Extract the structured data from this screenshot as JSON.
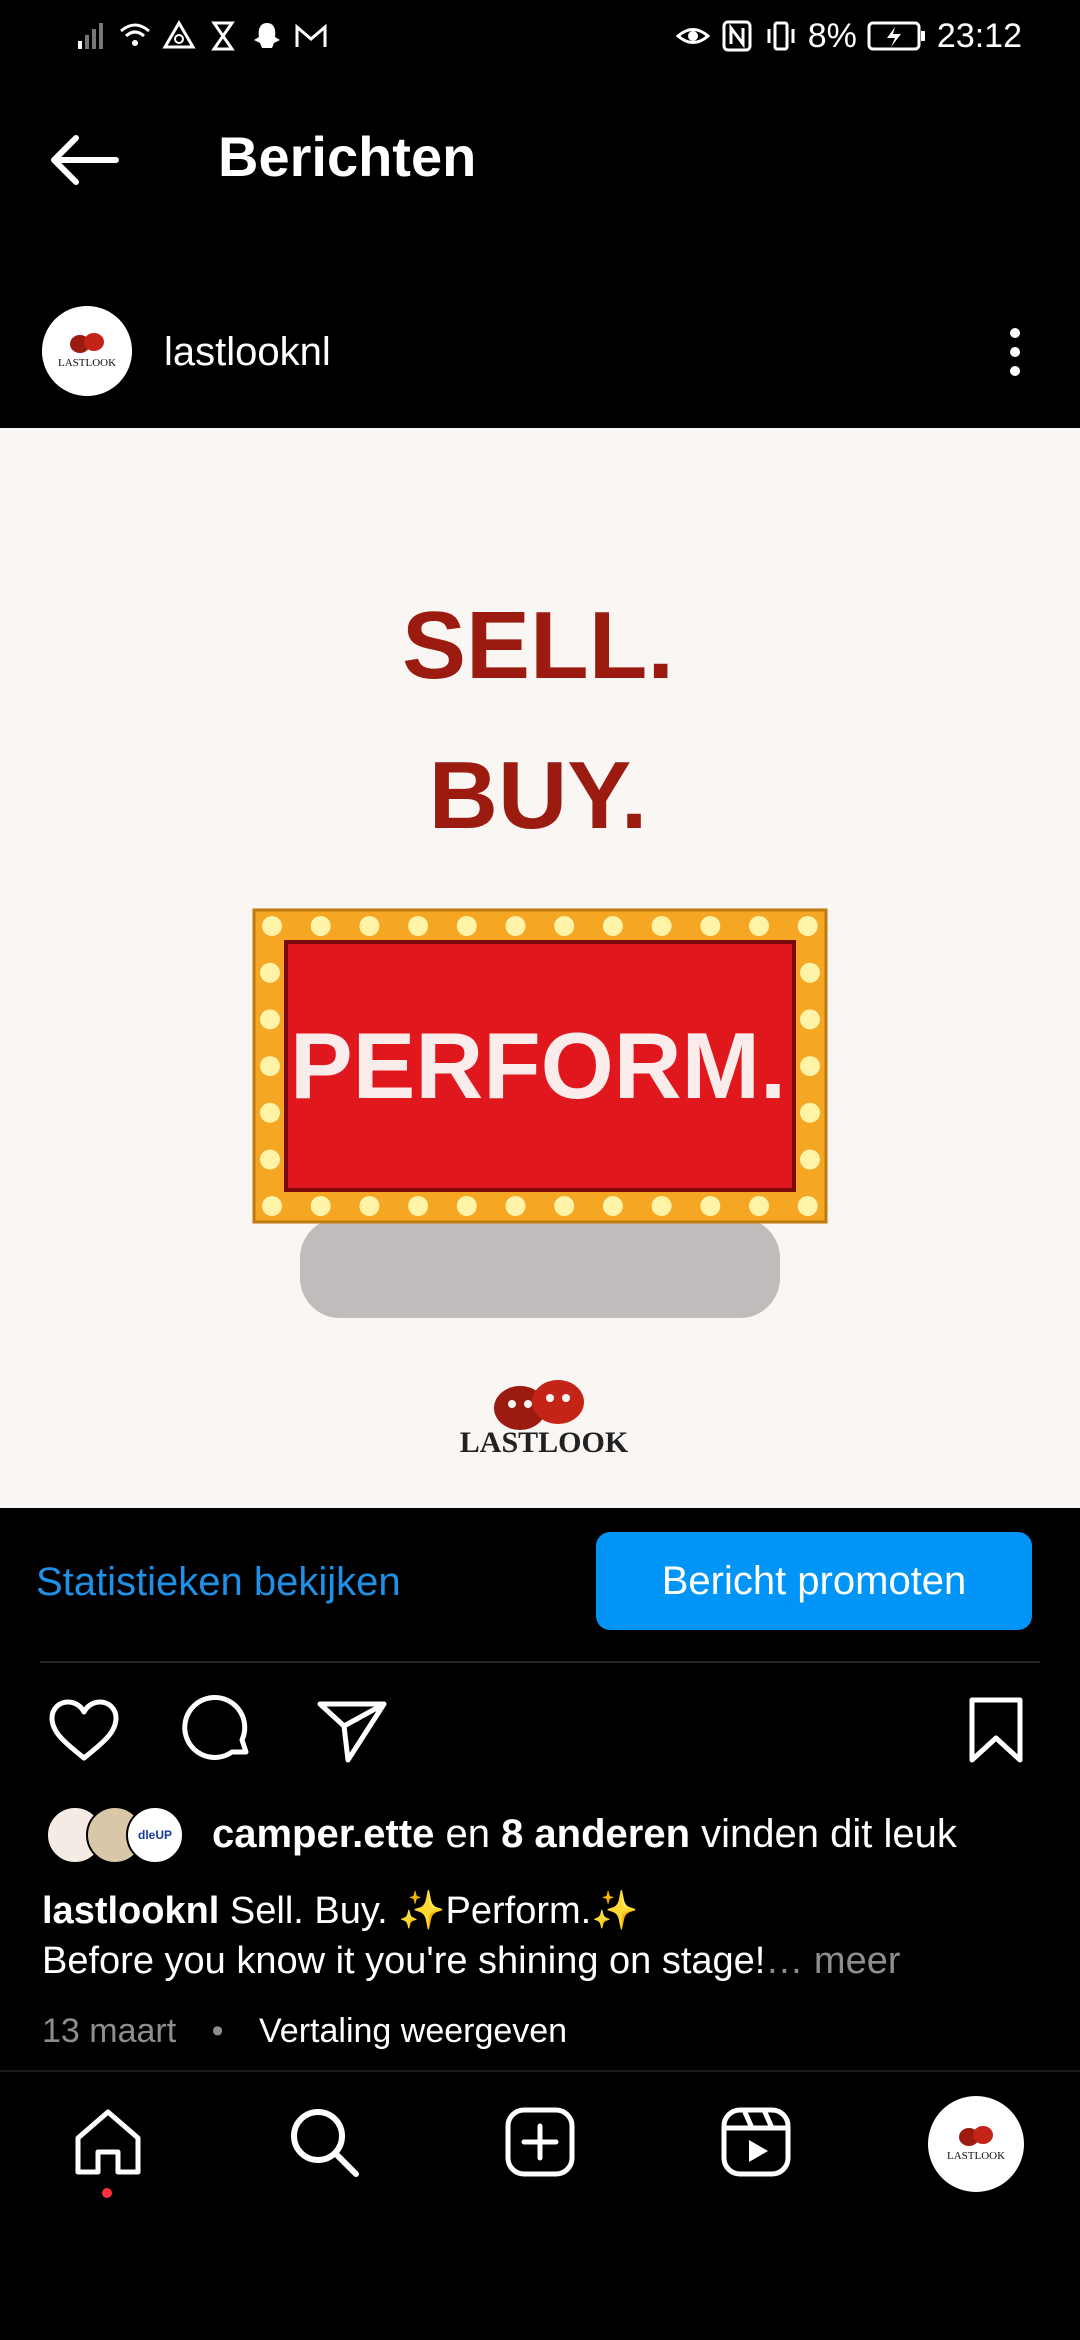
{
  "status_bar": {
    "battery": "8%",
    "time": "23:12",
    "left_icons": [
      "signal-icon",
      "wifi-icon",
      "data-icon",
      "hourglass-icon",
      "snapchat-icon",
      "gmail-icon"
    ],
    "right_icons": [
      "eye-icon",
      "nfc-icon",
      "vibrate-icon",
      "battery-icon"
    ]
  },
  "header": {
    "title": "Berichten"
  },
  "post": {
    "username": "lastlooknl",
    "image": {
      "line1": "SELL.",
      "line2": "BUY.",
      "sign": "PERFORM.",
      "logo_text": "LASTLOOK",
      "text_color": "#9b1b10",
      "sign_color": "#e0171d",
      "frame_color": "#f5a623"
    },
    "insights_link": "Statistieken bekijken",
    "promote_button": "Bericht promoten",
    "likes": {
      "first_user": "camper.ette",
      "connector": " en ",
      "others": "8 anderen",
      "suffix": " vinden dit leuk",
      "avatar_labels": [
        "",
        "",
        "dleUP"
      ]
    },
    "caption": {
      "user": "lastlooknl",
      "text": " Sell. Buy. ✨Perform.✨",
      "line2": "Before you know it you're shining on stage!",
      "more_label": "… meer"
    },
    "date": "13 maart",
    "separator": "•",
    "translate": "Vertaling weergeven"
  },
  "colors": {
    "accent": "#0095f6",
    "link": "#1e90e6",
    "background": "#000000"
  }
}
